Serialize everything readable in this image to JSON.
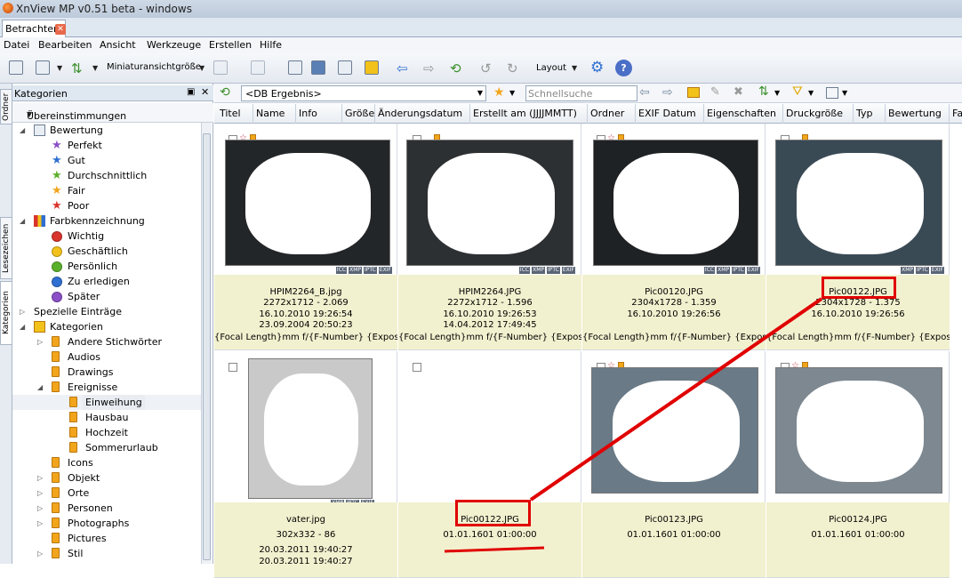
{
  "window": {
    "title": "XnView MP v0.51 beta - windows"
  },
  "tab": {
    "label": "Betrachter"
  },
  "menu": [
    "Datei",
    "Bearbeiten",
    "Ansicht",
    "Werkzeuge",
    "Erstellen",
    "Hilfe"
  ],
  "toolbar": {
    "thumb_size_label": "Miniaturansichtgröße",
    "layout_label": "Layout"
  },
  "side_tabs": [
    "Ordner",
    "Lesezeichen",
    "Kategorien"
  ],
  "panel": {
    "title": "Kategorien",
    "filter": "Übereinstimmungen",
    "tree": [
      {
        "label": "Bewertung",
        "level": 0,
        "icon": "rating-icon",
        "expanded": true
      },
      {
        "label": "Perfekt",
        "level": 1,
        "icon": "star-purple"
      },
      {
        "label": "Gut",
        "level": 1,
        "icon": "star-blue"
      },
      {
        "label": "Durchschnittlich",
        "level": 1,
        "icon": "star-green"
      },
      {
        "label": "Fair",
        "level": 1,
        "icon": "star-orange"
      },
      {
        "label": "Poor",
        "level": 1,
        "icon": "star-red"
      },
      {
        "label": "Farbkennzeichnung",
        "level": 0,
        "icon": "color-label-icon",
        "expanded": true
      },
      {
        "label": "Wichtig",
        "level": 1,
        "icon": "dot",
        "color": "#d9342b"
      },
      {
        "label": "Geschäftlich",
        "level": 1,
        "icon": "dot",
        "color": "#f2c21b"
      },
      {
        "label": "Persönlich",
        "level": 1,
        "icon": "dot",
        "color": "#5bb02a"
      },
      {
        "label": "Zu erledigen",
        "level": 1,
        "icon": "dot",
        "color": "#2f6fd1"
      },
      {
        "label": "Später",
        "level": 1,
        "icon": "dot",
        "color": "#8b4fc7"
      },
      {
        "label": "Spezielle Einträge",
        "level": 0,
        "icon": "none",
        "expanded": false
      },
      {
        "label": "Kategorien",
        "level": 0,
        "icon": "folder-icon",
        "expanded": true
      },
      {
        "label": "Andere Stichwörter",
        "level": 1,
        "icon": "flag",
        "expandable": true
      },
      {
        "label": "Audios",
        "level": 1,
        "icon": "flag"
      },
      {
        "label": "Drawings",
        "level": 1,
        "icon": "flag"
      },
      {
        "label": "Ereignisse",
        "level": 1,
        "icon": "flag",
        "expanded": true
      },
      {
        "label": "Einweihung",
        "level": 2,
        "icon": "flag",
        "selected": true
      },
      {
        "label": "Hausbau",
        "level": 2,
        "icon": "flag"
      },
      {
        "label": "Hochzeit",
        "level": 2,
        "icon": "flag"
      },
      {
        "label": "Sommerurlaub",
        "level": 2,
        "icon": "flag"
      },
      {
        "label": "Icons",
        "level": 1,
        "icon": "flag"
      },
      {
        "label": "Objekt",
        "level": 1,
        "icon": "flag",
        "expandable": true
      },
      {
        "label": "Orte",
        "level": 1,
        "icon": "flag",
        "expandable": true
      },
      {
        "label": "Personen",
        "level": 1,
        "icon": "flag",
        "expandable": true
      },
      {
        "label": "Photographs",
        "level": 1,
        "icon": "flag",
        "expandable": true
      },
      {
        "label": "Pictures",
        "level": 1,
        "icon": "flag"
      },
      {
        "label": "Stil",
        "level": 1,
        "icon": "flag",
        "expandable": true
      }
    ]
  },
  "address": {
    "path": "<DB Ergebnis>",
    "search_placeholder": "Schnellsuche"
  },
  "columns": [
    "Titel",
    "Name",
    "Info",
    "Größe",
    "Änderungsdatum",
    "Erstellt am (JJJJMMTT)",
    "Ordner",
    "EXIF Datum",
    "Eigenschaften",
    "Druckgröße",
    "Typ",
    "Bewertung",
    "Fa"
  ],
  "files": [
    {
      "name": "HPIM2264_B.jpg",
      "dims": "2272x1712 - 2.069",
      "modified": "16.10.2010 19:26:54",
      "created": "23.09.2004 20:50:23",
      "exif": "{Focal Length}mm f/{F-Number} {Exposur..."
    },
    {
      "name": "HPIM2264.JPG",
      "dims": "2272x1712 - 1.596",
      "modified": "16.10.2010 19:26:53",
      "created": "14.04.2012 17:49:45",
      "exif": "{Focal Length}mm f/{F-Number} {Exposur..."
    },
    {
      "name": "Pic00120.JPG",
      "dims": "2304x1728 - 1.359",
      "modified": "16.10.2010 19:26:56",
      "created": "",
      "exif": "{Focal Length}mm f/{F-Number} {Exposur..."
    },
    {
      "name": "Pic00122.JPG",
      "dims": "2304x1728 - 1.375",
      "modified": "16.10.2010 19:26:56",
      "created": "",
      "exif": "{Focal Length}mm f/{F-Number} {Exposur..."
    },
    {
      "name": "vater.jpg",
      "dims": "302x332 - 86",
      "modified": "20.03.2011 19:40:27",
      "created": "20.03.2011 19:40:27",
      "exif": ""
    },
    {
      "name": "Pic00122.JPG",
      "dims": "01.01.1601 01:00:00",
      "modified": "",
      "created": "",
      "exif": ""
    },
    {
      "name": "Pic00123.JPG",
      "dims": "01.01.1601 01:00:00",
      "modified": "",
      "created": "",
      "exif": ""
    },
    {
      "name": "Pic00124.JPG",
      "dims": "01.01.1601 01:00:00",
      "modified": "",
      "created": "",
      "exif": ""
    }
  ],
  "thumb_tags": [
    "ICC",
    "XMP",
    "IPTC",
    "EXIF"
  ],
  "colors": {
    "highlight": "#e00000",
    "info_bg": "#f2f1cf",
    "title_bar": "#bccadb"
  }
}
